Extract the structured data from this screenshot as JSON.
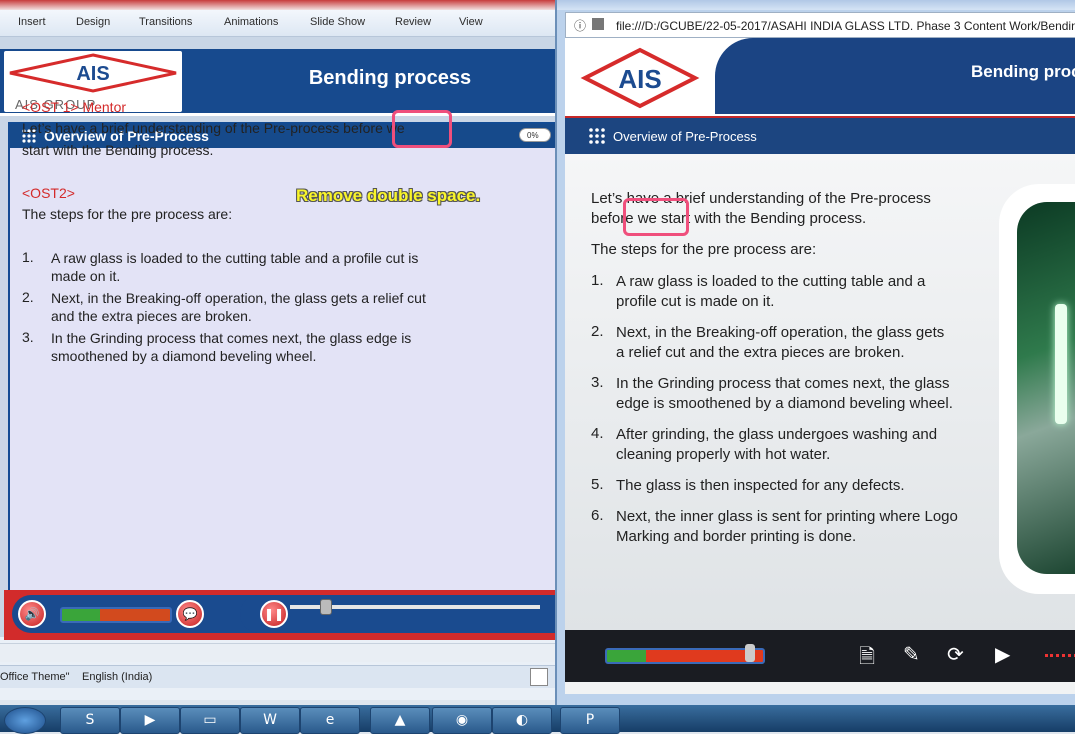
{
  "ppt": {
    "ribbon_tabs": [
      "Insert",
      "Design",
      "Transitions",
      "Animations",
      "Slide Show",
      "Review",
      "View"
    ],
    "status": {
      "theme": "Office Theme\"",
      "language": "English (India)"
    }
  },
  "left_slide": {
    "logo_text": "AIS",
    "group_text": "AIS GROUP",
    "title": "Bending process",
    "panel_title": "Overview of Pre-Process",
    "progress": "0%",
    "ost1": "<OST 1> Mentor",
    "intro_line1": "Let’s have a brief understanding of the Pre-process before  we",
    "intro_line2": "start with the Bending process.",
    "ost2": "<OST2>",
    "steps_heading": "The steps for the pre process are:",
    "steps": [
      {
        "num": "1.",
        "text": "A raw glass is loaded to the cutting table and a profile cut is\nmade on it."
      },
      {
        "num": "2.",
        "text": "Next, in the Breaking-off operation, the glass gets a relief cut\nand the extra pieces are broken."
      },
      {
        "num": "3.",
        "text": "In the Grinding process that comes next, the glass edge is\nsmoothened by a diamond beveling wheel."
      }
    ],
    "annotation": "Remove double space."
  },
  "browser": {
    "url": "file:///D:/GCUBE/22-05-2017/ASAHI INDIA GLASS LTD. Phase 3 Content Work/Bending"
  },
  "right_slide": {
    "logo_text": "AIS",
    "title": "Bending proc",
    "panel_title": "Overview of Pre-Process",
    "intro_line1": "Let’s have a brief understanding of the Pre-process",
    "intro_line2": "before  we  start with the Bending process.",
    "steps_heading": "The steps for the pre process are:",
    "steps": [
      {
        "num": "1.",
        "text": "A raw glass is loaded to the cutting table and a\nprofile cut is made on it."
      },
      {
        "num": "2.",
        "text": "Next, in the Breaking-off operation, the glass  gets\na relief cut and the extra pieces are broken."
      },
      {
        "num": "3.",
        "text": "In the Grinding process that comes next, the glass\nedge is smoothened by a diamond beveling wheel."
      },
      {
        "num": "4.",
        "text": "After grinding, the glass undergoes washing and\ncleaning properly with hot water."
      },
      {
        "num": "5.",
        "text": "The glass is then inspected for any defects."
      },
      {
        "num": "6.",
        "text": "Next, the inner glass is sent for printing  where Logo\nMarking and border printing is done."
      }
    ]
  },
  "taskbar": {
    "items": [
      "start-orb",
      "skype",
      "media",
      "folder",
      "word",
      "ie",
      "vlc",
      "chrome",
      "firefox",
      "powerpoint"
    ]
  }
}
